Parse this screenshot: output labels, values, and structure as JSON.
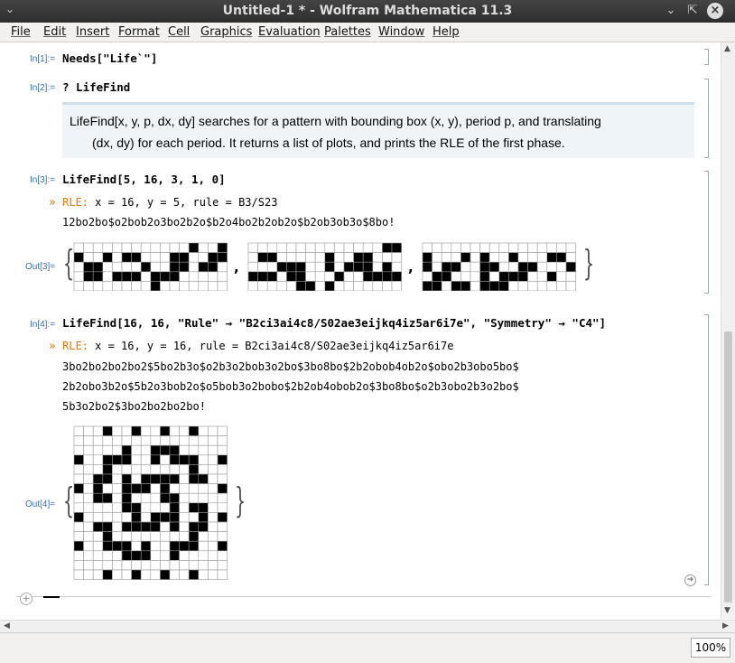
{
  "window": {
    "title": "Untitled-1 * - Wolfram Mathematica 11.3"
  },
  "menu": [
    "File",
    "Edit",
    "Insert",
    "Format",
    "Cell",
    "Graphics",
    "Evaluation",
    "Palettes",
    "Window",
    "Help"
  ],
  "cells": {
    "in1": {
      "label": "In[1]:=",
      "code": "Needs[\"Life`\"]"
    },
    "in2": {
      "label": "In[2]:=",
      "code": "? LifeFind"
    },
    "usage": {
      "line1": "LifeFind[x, y, p, dx, dy] searches for a pattern with bounding box (x, y), period p, and translating",
      "line2": "(dx, dy) for each period. It returns a list of plots, and prints the RLE of the first phase."
    },
    "in3": {
      "label": "In[3]:=",
      "code": "LifeFind[5, 16, 3, 1, 0]",
      "rle_prefix": "RLE:",
      "rle_header": " x = 16, y = 5, rule = B3/S23",
      "rle_body": [
        "12bo2bo$o2bob2o3bo2b2o$b2o4bo2b2ob2o$b2ob3ob3o$8bo!"
      ]
    },
    "out3": {
      "label": "Out[3]="
    },
    "in4": {
      "label": "In[4]:=",
      "code": "LifeFind[16, 16, \"Rule\" → \"B2ci3ai4c8/S02ae3eijkq4iz5ar6i7e\", \"Symmetry\" → \"C4\"]",
      "rle_prefix": "RLE:",
      "rle_header": " x = 16, y = 16, rule = B2ci3ai4c8/S02ae3eijkq4iz5ar6i7e",
      "rle_body": [
        "3bo2bo2bo2bo2$5bo2b3o$o2b3o2bob3o2bo$3bo8bo$2b2obob4ob2o$obo2b3obo5bo$",
        "2b2obo3b2o$5b2o3bob2o$o5bob3o2bobo$2b2ob4obob2o$3bo8bo$o2b3obo2b3o2bo$",
        "5b3o2bo2$3bo2bo2bo2bo!"
      ]
    },
    "out4": {
      "label": "Out[4]="
    }
  },
  "plots": {
    "out3": [
      [
        "............X..X",
        "X..X.XX...XX..XX",
        ".XX....X..XX.XX.",
        ".XX.XXX.XXX.....",
        "........X......."
      ],
      [
        "..............XX",
        ".XX.....X..XX...",
        "...XXX..X.XXX.X.",
        "XXX.XX...X..XXXX",
        ".....XX.X......."
      ],
      [
        "................",
        "X...X.X..X...XX.",
        "X.XX..XX..XX...X",
        ".XX...X.XXX..X..",
        "XX.XX.XXX......."
      ]
    ],
    "out4": [
      "...X..X..X..X...",
      "................",
      ".....X..XXX.....",
      "X..XXX..X.XXX..X",
      "...X........X...",
      "..XX.X.XXXX.XX..",
      "X.X..XXX.X.....X",
      "..XX.X...XX.....",
      ".....XX...X.XX..",
      "X.....X.XXX..X.X",
      "..XX.XXXX.X.XX..",
      "...X........X...",
      "X..XXX.X..XXX..X",
      ".....XXX..X.....",
      "................",
      "...X..X..X..X..."
    ]
  },
  "zoom": "100%"
}
